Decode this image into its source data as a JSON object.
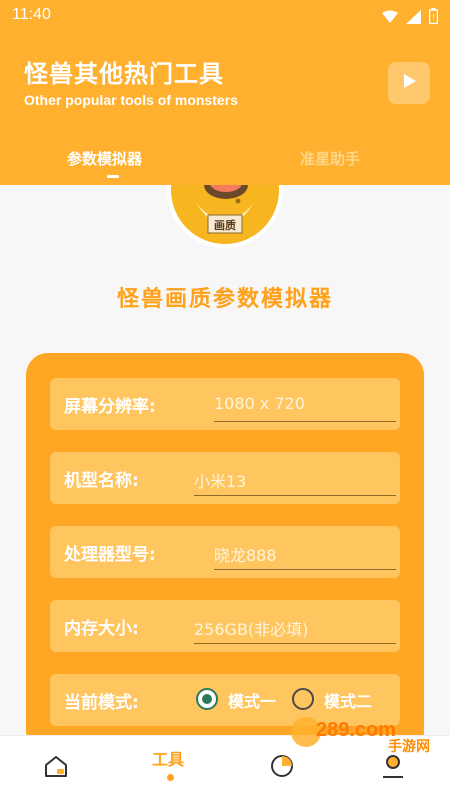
{
  "status": {
    "time": "11:40"
  },
  "header": {
    "title": "怪兽其他热门工具",
    "subtitle": "Other popular tools of monsters"
  },
  "tabs": [
    {
      "label": "参数模拟器"
    },
    {
      "label": "准星助手"
    }
  ],
  "tool": {
    "title": "怪兽画质参数模拟器",
    "avatar_badge": "画质"
  },
  "form": {
    "resolution": {
      "label": "屏幕分辨率:",
      "value": "1080 x 720"
    },
    "model": {
      "label": "机型名称:",
      "value": "小米13"
    },
    "processor": {
      "label": "处理器型号:",
      "value": "晓龙888"
    },
    "memory": {
      "label": "内存大小:",
      "value": "256GB(非必填)"
    },
    "mode": {
      "label": "当前模式:",
      "option1": "模式一",
      "option2": "模式二"
    }
  },
  "bottom_nav": {
    "active_label": "工具"
  },
  "watermark": {
    "text": "289.com",
    "subtext": "手游网"
  }
}
